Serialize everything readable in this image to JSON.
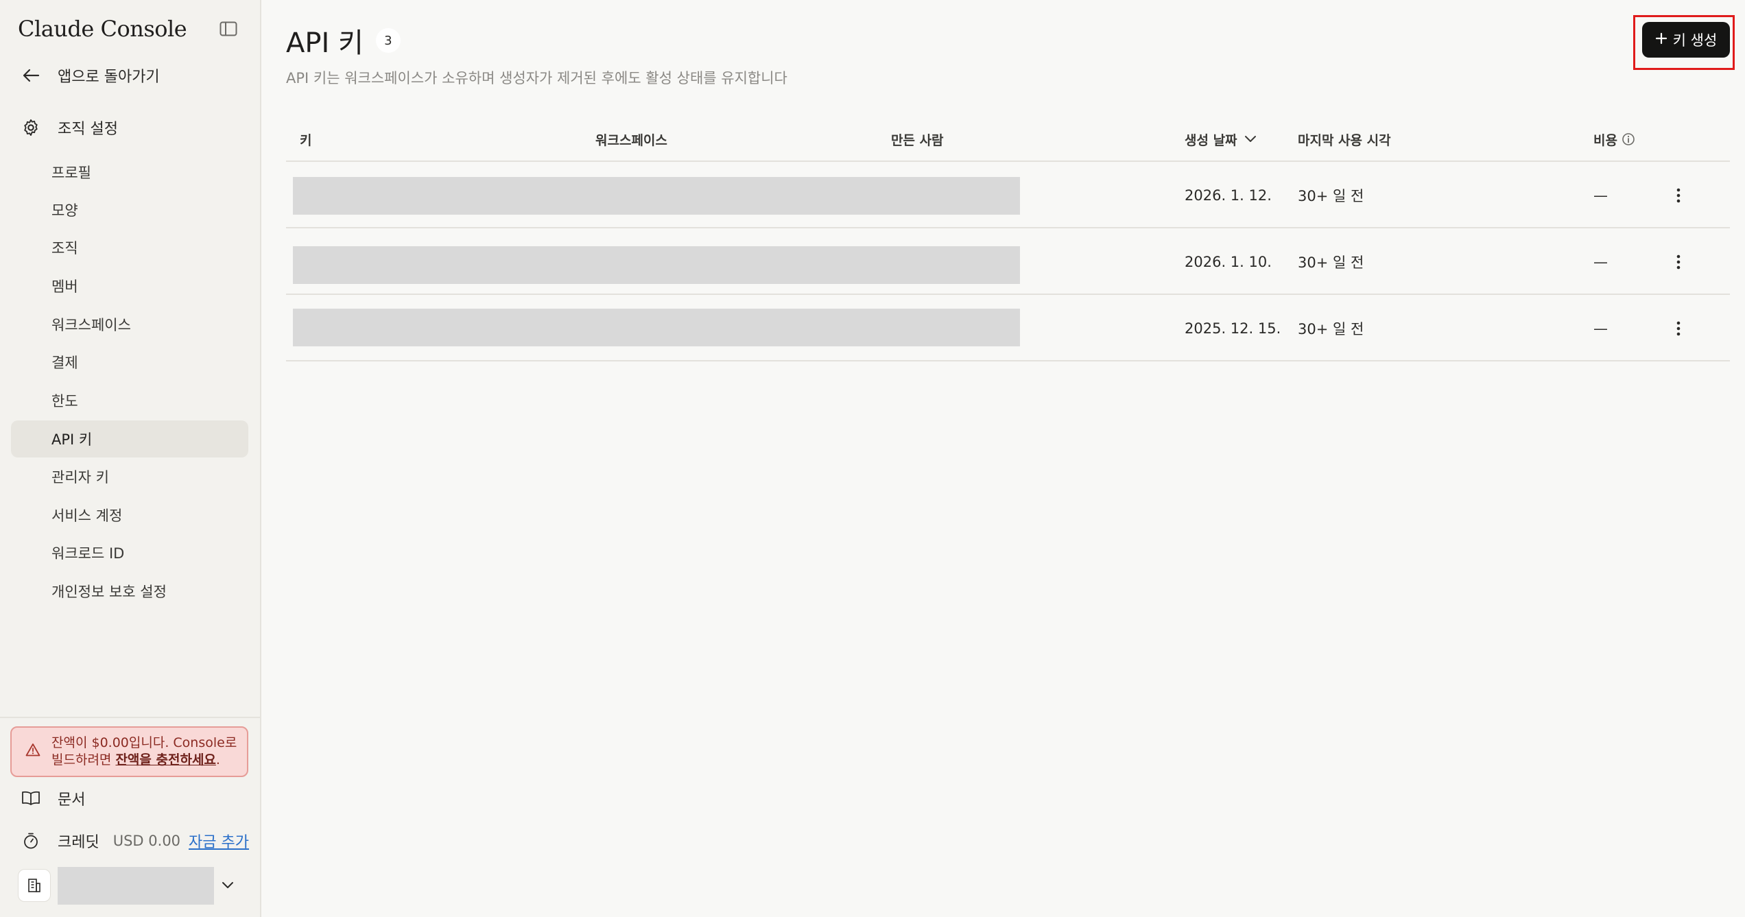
{
  "sidebar": {
    "brand": "Claude Console",
    "back_label": "앱으로 돌아가기",
    "section_label": "조직 설정",
    "items": [
      {
        "label": "프로필"
      },
      {
        "label": "모양"
      },
      {
        "label": "조직"
      },
      {
        "label": "멤버"
      },
      {
        "label": "워크스페이스"
      },
      {
        "label": "결제"
      },
      {
        "label": "한도"
      },
      {
        "label": "API 키",
        "active": true
      },
      {
        "label": "관리자 키"
      },
      {
        "label": "서비스 계정"
      },
      {
        "label": "워크로드 ID"
      },
      {
        "label": "개인정보 보호 설정"
      }
    ],
    "alert": {
      "line1": "잔액이 $0.00입니다. Console로",
      "line2_prefix": "빌드하려면 ",
      "link": "잔액을 충전하세요",
      "line2_suffix": "."
    },
    "docs_label": "문서",
    "credits": {
      "label": "크레딧",
      "value": "USD 0.00",
      "link": "자금 추가"
    }
  },
  "main": {
    "title": "API 키",
    "count": "3",
    "subtitle": "API 키는 워크스페이스가 소유하며 생성자가 제거된 후에도 활성 상태를 유지합니다",
    "create_button": "키 생성",
    "columns": {
      "key": "키",
      "workspace": "워크스페이스",
      "creator": "만든 사람",
      "created": "생성 날짜",
      "last_used": "마지막 사용 시각",
      "cost": "비용"
    },
    "rows": [
      {
        "created": "2026. 1. 12.",
        "last_used": "30+ 일 전",
        "cost": "—"
      },
      {
        "created": "2026. 1. 10.",
        "last_used": "30+ 일 전",
        "cost": "—"
      },
      {
        "created": "2025. 12. 15.",
        "last_used": "30+ 일 전",
        "cost": "—"
      }
    ]
  },
  "icons": {
    "sidebar_toggle": "sidebar-toggle-icon",
    "back": "arrow-left-icon",
    "settings": "gear-icon",
    "warning": "warning-icon",
    "docs": "book-icon",
    "credits": "timer-icon",
    "org": "building-icon",
    "chevron": "chevron-down-icon",
    "sort": "sort-down-icon",
    "info": "info-icon",
    "more": "more-vertical-icon",
    "plus": "plus-icon"
  },
  "colors": {
    "primary_button": "#141413",
    "alert_bg": "#f9d9d7",
    "alert_border": "#e69c97",
    "link": "#2a6fc9",
    "highlight": "#e01b1b"
  }
}
